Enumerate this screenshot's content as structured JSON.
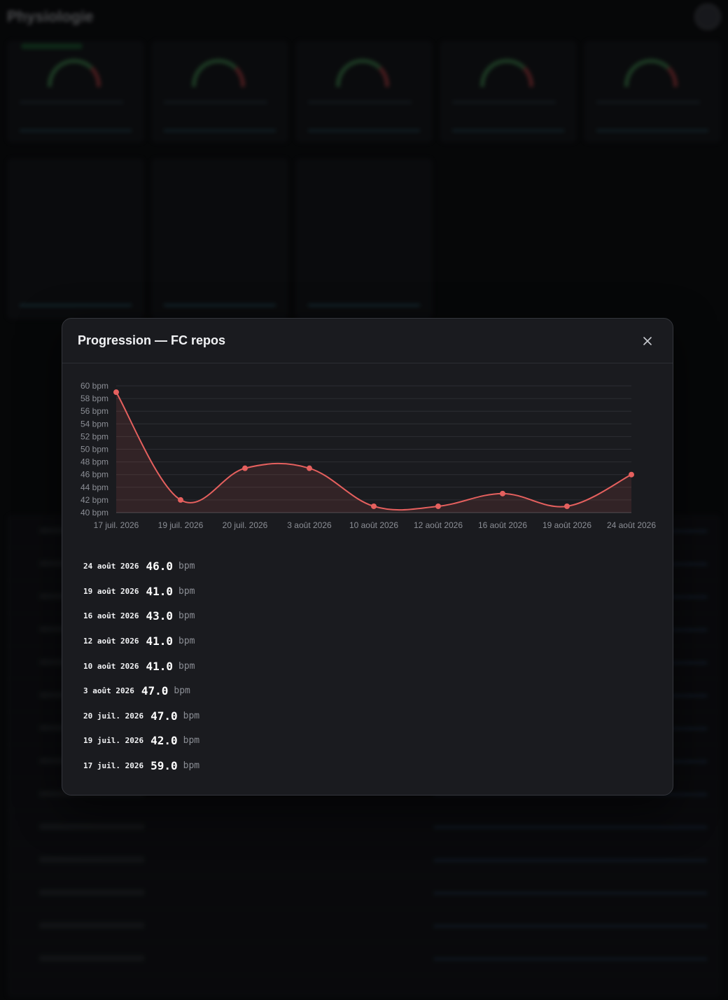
{
  "app": {
    "title": "Physiologie"
  },
  "modal": {
    "title": "Progression — FC repos",
    "close_label": "×"
  },
  "colors": {
    "line": "#e5605e",
    "background": "#1a1b1f"
  },
  "chart_data": {
    "type": "line",
    "title": "",
    "xlabel": "",
    "ylabel": "",
    "unit": "bpm",
    "ylim": [
      40,
      60
    ],
    "yticks": [
      "40 bpm",
      "42 bpm",
      "44 bpm",
      "46 bpm",
      "48 bpm",
      "50 bpm",
      "52 bpm",
      "54 bpm",
      "56 bpm",
      "58 bpm",
      "60 bpm"
    ],
    "categories": [
      "17 juil. 2026",
      "19 juil. 2026",
      "20 juil. 2026",
      "3 août 2026",
      "10 août 2026",
      "12 août 2026",
      "16 août 2026",
      "19 août 2026",
      "24 août 2026"
    ],
    "values": [
      59,
      42,
      47,
      47,
      41,
      41,
      43,
      41,
      46
    ],
    "grid": true,
    "fill": true
  },
  "entries": [
    {
      "date": "24 août 2026",
      "value": "46.0",
      "unit": "bpm"
    },
    {
      "date": "19 août 2026",
      "value": "41.0",
      "unit": "bpm"
    },
    {
      "date": "16 août 2026",
      "value": "43.0",
      "unit": "bpm"
    },
    {
      "date": "12 août 2026",
      "value": "41.0",
      "unit": "bpm"
    },
    {
      "date": "10 août 2026",
      "value": "41.0",
      "unit": "bpm"
    },
    {
      "date": "3 août 2026",
      "value": "47.0",
      "unit": "bpm"
    },
    {
      "date": "20 juil. 2026",
      "value": "47.0",
      "unit": "bpm"
    },
    {
      "date": "19 juil. 2026",
      "value": "42.0",
      "unit": "bpm"
    },
    {
      "date": "17 juil. 2026",
      "value": "59.0",
      "unit": "bpm"
    }
  ]
}
